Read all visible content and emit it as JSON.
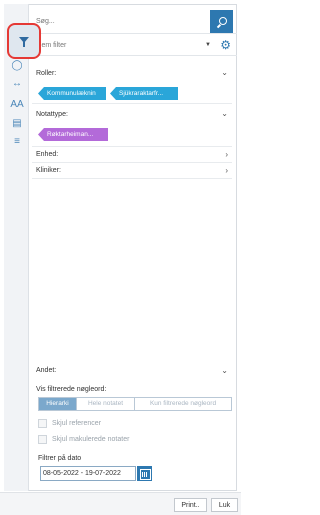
{
  "search": {
    "placeholder": "Søg..."
  },
  "filter_select": {
    "label": "Gem filter"
  },
  "sections": {
    "roller": {
      "title": "Roller:",
      "tags": [
        "Kommunulæknin",
        "Sjükraraktarfr..."
      ]
    },
    "notattype": {
      "title": "Notattype:",
      "tags": [
        "Røktarheiman..."
      ]
    },
    "enhed": {
      "title": "Enhed:"
    },
    "kliniker": {
      "title": "Kliniker:"
    }
  },
  "andet": {
    "title": "Andet:",
    "vis_label": "Vis filtrerede nøgleord:",
    "segments": [
      "Hierarki",
      "Hele notatet",
      "Kun filtrerede nøgleord"
    ],
    "checkboxes": [
      "Skjul referencer",
      "Skjul makulerede notater"
    ],
    "date_label": "Filtrer på dato",
    "date_value": "08-05-2022 - 19-07-2022"
  },
  "footer": {
    "print_label": "Print..",
    "close_label": "Luk"
  },
  "colors": {
    "accent": "#2d78b0",
    "tag_blue": "#2aa6d9",
    "tag_purple": "#b36ad9",
    "highlight": "#e53935"
  }
}
